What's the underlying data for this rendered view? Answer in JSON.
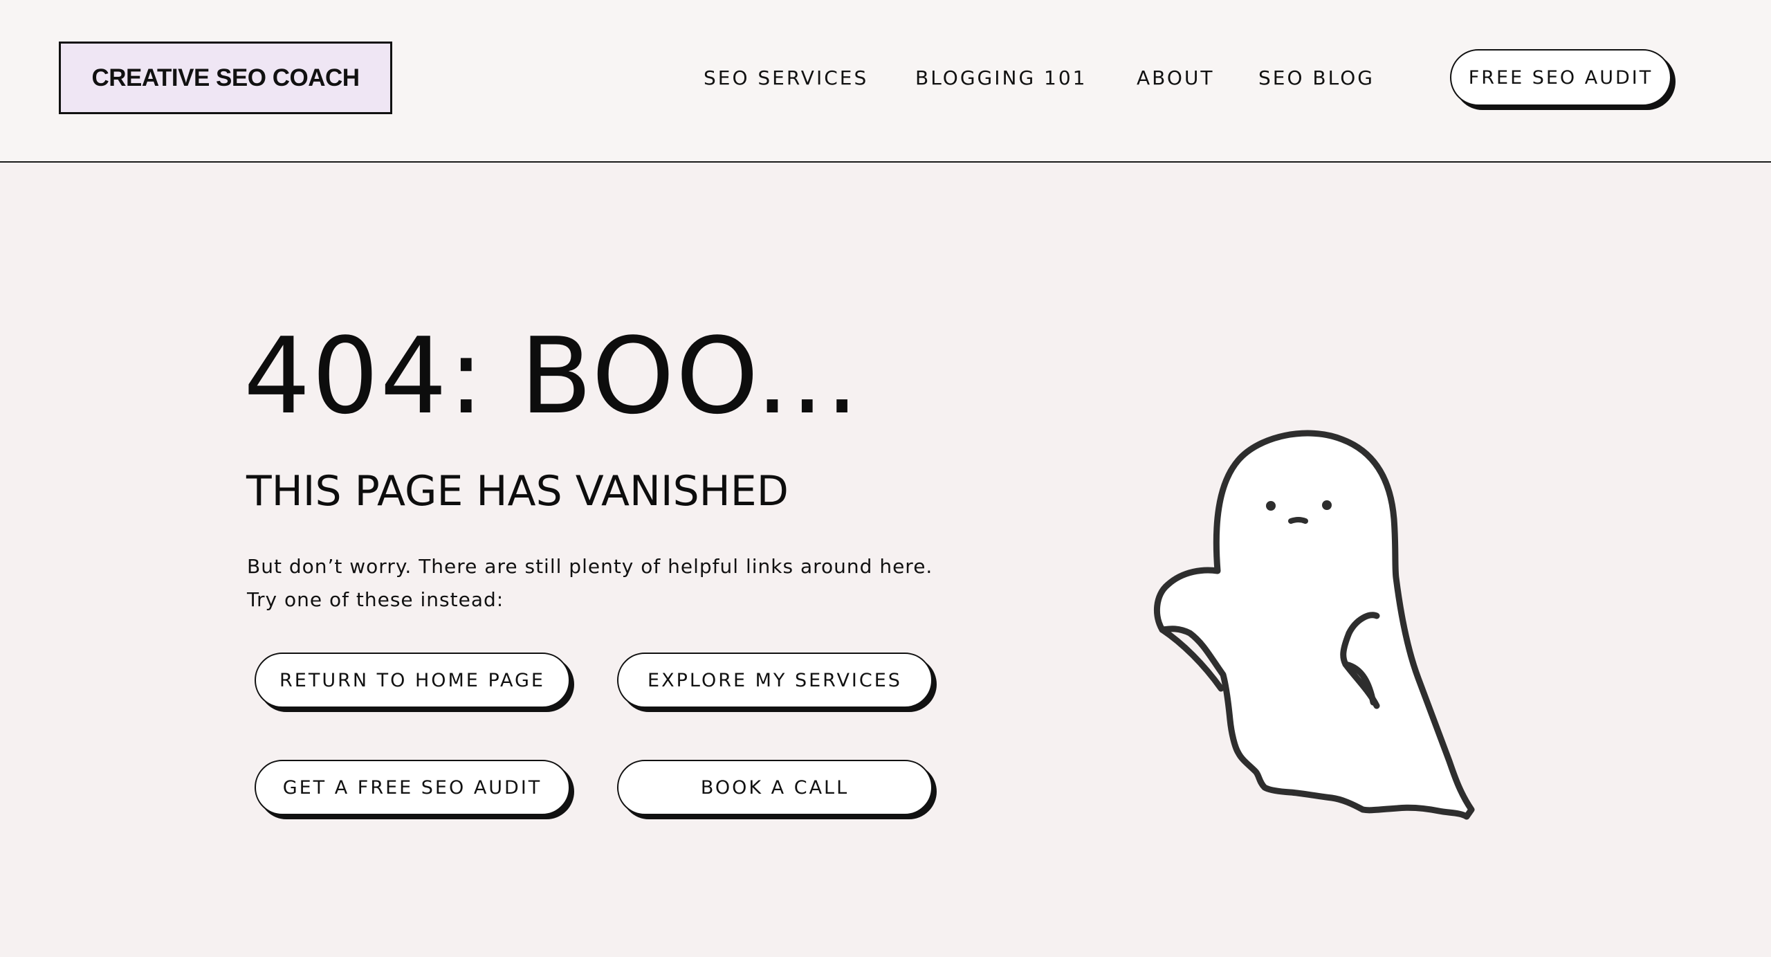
{
  "header": {
    "logo": "CREATIVE SEO COACH",
    "nav": [
      "SEO SERVICES",
      "BLOGGING 101",
      "ABOUT",
      "SEO BLOG"
    ],
    "cta": "FREE SEO AUDIT"
  },
  "hero": {
    "title": "404: BOO...",
    "subtitle": "THIS PAGE HAS VANISHED",
    "text_line1": "But don’t worry. There are still plenty of helpful links around here.",
    "text_line2": "Try one of these instead:",
    "buttons": {
      "home": "RETURN TO HOME PAGE",
      "services": "EXPLORE MY SERVICES",
      "audit": "GET A FREE SEO AUDIT",
      "call": "BOOK A CALL"
    }
  },
  "icons": {
    "illustration": "ghost-illustration"
  },
  "colors": {
    "background": "#f6f1f1",
    "header_bg": "#f8f5f4",
    "logo_bg": "#efe6f4",
    "button_bg": "#ffffff",
    "ink": "#111111"
  }
}
